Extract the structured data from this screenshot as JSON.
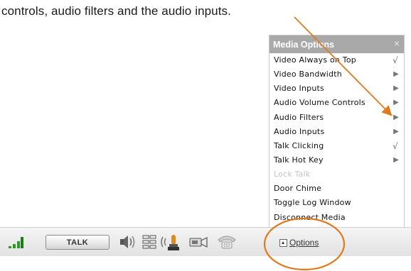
{
  "caption": "controls, audio filters and the audio inputs.",
  "menu": {
    "title": "Media Options",
    "close_glyph": "×",
    "items": [
      {
        "label": "Video Always on Top",
        "indicator": "√"
      },
      {
        "label": "Video Bandwidth",
        "indicator": "▶"
      },
      {
        "label": "Video Inputs",
        "indicator": "▶"
      },
      {
        "label": "Audio Volume Controls",
        "indicator": "▶"
      },
      {
        "label": "Audio Filters",
        "indicator": "▶"
      },
      {
        "label": "Audio Inputs",
        "indicator": "▶"
      },
      {
        "label": "Talk Clicking",
        "indicator": "√"
      },
      {
        "label": "Talk Hot Key",
        "indicator": "▶"
      },
      {
        "label": "Lock Talk",
        "indicator": "",
        "disabled": true
      },
      {
        "label": "Door Chime",
        "indicator": ""
      },
      {
        "label": "Toggle Log Window",
        "indicator": ""
      },
      {
        "label": "Disconnect Media",
        "indicator": ""
      }
    ]
  },
  "toolbar": {
    "talk_label": "TALK",
    "options_label": "Options",
    "icons": [
      "signal-strength-icon",
      "speaker-volume-icon",
      "audio-filter-icon",
      "microphone-input-icon",
      "video-camera-icon",
      "phone-icon"
    ]
  },
  "annotation": {
    "arrow_color": "#e07a20",
    "circle_color": "#e07a20"
  }
}
